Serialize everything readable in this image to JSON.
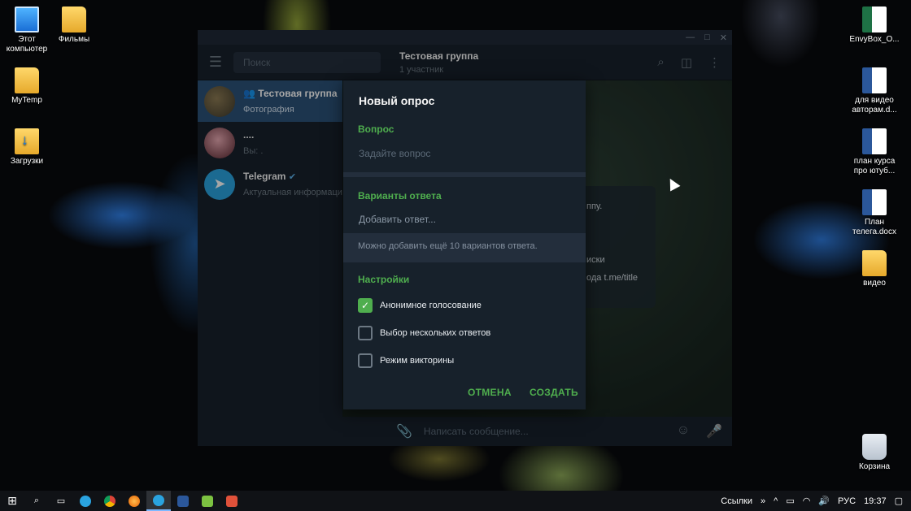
{
  "desktop": {
    "left_icons": [
      {
        "label": "Этот\nкомпьютер",
        "icon": "computer-icon"
      },
      {
        "label": "Фильмы",
        "icon": "folder-icon"
      },
      {
        "label": "MyTemp",
        "icon": "folder-icon"
      },
      {
        "label": "Загрузки",
        "icon": "downloads-folder-icon"
      }
    ],
    "right_icons": [
      {
        "label": "EnvyBox_O...",
        "icon": "excel-file-icon"
      },
      {
        "label": "для видео\nавторам.d...",
        "icon": "word-file-icon"
      },
      {
        "label": "план курса\nпро ютуб...",
        "icon": "word-file-icon"
      },
      {
        "label": "План\nтелега.docx",
        "icon": "word-file-icon"
      },
      {
        "label": "видео",
        "icon": "folder-icon"
      },
      {
        "label": "Корзина",
        "icon": "recycle-bin-icon"
      }
    ]
  },
  "telegram": {
    "search_placeholder": "Поиск",
    "header": {
      "title": "Тестовая группа",
      "subtitle": "1 участник"
    },
    "chats": [
      {
        "name": "Тестовая группа",
        "preview": "Фотография",
        "active": true
      },
      {
        "name": "....",
        "preview": "Вы: .",
        "active": false
      },
      {
        "name": "Telegram",
        "preview": "Актуальная информаци",
        "active": false
      }
    ],
    "message_fragments": [
      "ппу.",
      "иски",
      "ода t.me/title"
    ],
    "input_placeholder": "Написать сообщение..."
  },
  "poll_dialog": {
    "title": "Новый опрос",
    "question_label": "Вопрос",
    "question_placeholder": "Задайте вопрос",
    "answers_label": "Варианты ответа",
    "answer_placeholder": "Добавить ответ...",
    "hint": "Можно добавить ещё 10 вариантов ответа.",
    "settings_label": "Настройки",
    "options": [
      {
        "label": "Анонимное голосование",
        "checked": true
      },
      {
        "label": "Выбор нескольких ответов",
        "checked": false
      },
      {
        "label": "Режим викторины",
        "checked": false
      }
    ],
    "cancel": "ОТМЕНА",
    "create": "СОЗДАТЬ"
  },
  "taskbar": {
    "links_label": "Ссылки",
    "chevron": "»",
    "lang": "РУС",
    "time": "19:37"
  },
  "colors": {
    "accent": "#4fae4e",
    "active_chat": "#2b5278",
    "window_bg": "#17212b"
  }
}
